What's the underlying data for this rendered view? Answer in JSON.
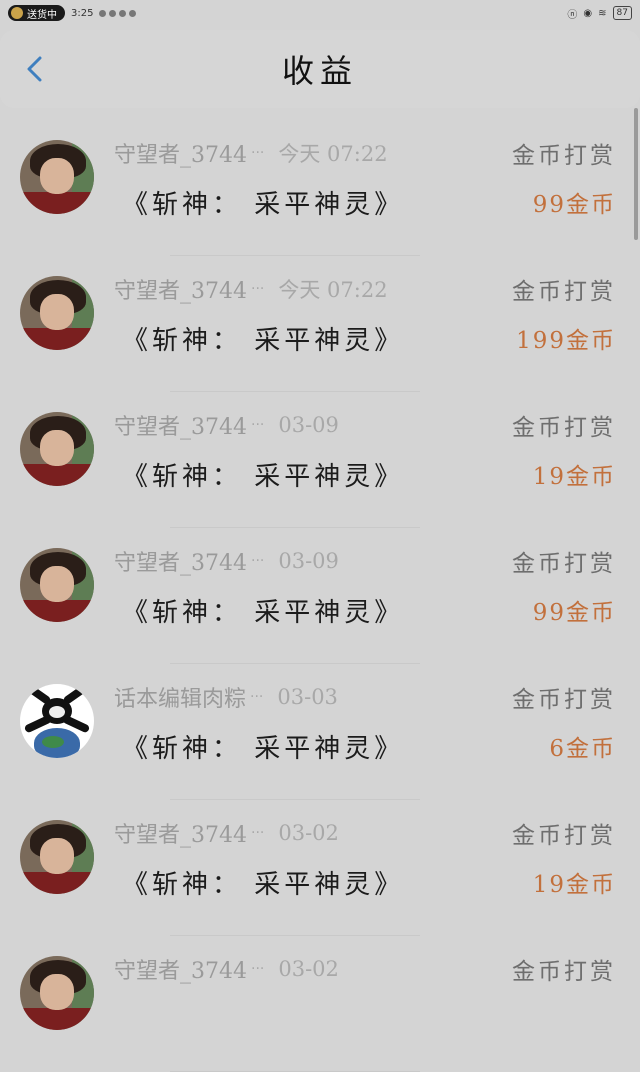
{
  "status_bar": {
    "pill_label": "送货中",
    "time": "3:25",
    "battery": "87"
  },
  "header": {
    "title": "收益"
  },
  "records": [
    {
      "user": "守望者_3744",
      "date": "今天 07:22",
      "type": "金币打赏",
      "book": "《斩神： 采平神灵》",
      "amount": "99金币",
      "avatar": "boy-avatar-icon"
    },
    {
      "user": "守望者_3744",
      "date": "今天 07:22",
      "type": "金币打赏",
      "book": "《斩神： 采平神灵》",
      "amount": "199金币",
      "avatar": "boy-avatar-icon"
    },
    {
      "user": "守望者_3744",
      "date": "03-09",
      "type": "金币打赏",
      "book": "《斩神： 采平神灵》",
      "amount": "19金币",
      "avatar": "boy-avatar-icon"
    },
    {
      "user": "守望者_3744",
      "date": "03-09",
      "type": "金币打赏",
      "book": "《斩神： 采平神灵》",
      "amount": "99金币",
      "avatar": "boy-avatar-icon"
    },
    {
      "user": "话本编辑肉粽",
      "date": "03-03",
      "type": "金币打赏",
      "book": "《斩神： 采平神灵》",
      "amount": "6金币",
      "avatar": "panda-globe-avatar-icon"
    },
    {
      "user": "守望者_3744",
      "date": "03-02",
      "type": "金币打赏",
      "book": "《斩神： 采平神灵》",
      "amount": "19金币",
      "avatar": "boy-avatar-icon"
    },
    {
      "user": "守望者_3744",
      "date": "03-02",
      "type": "金币打赏",
      "book": "",
      "amount": "",
      "avatar": "boy-avatar-icon"
    }
  ],
  "colors": {
    "amount": "#c2703c",
    "background": "#d4d4d4"
  }
}
